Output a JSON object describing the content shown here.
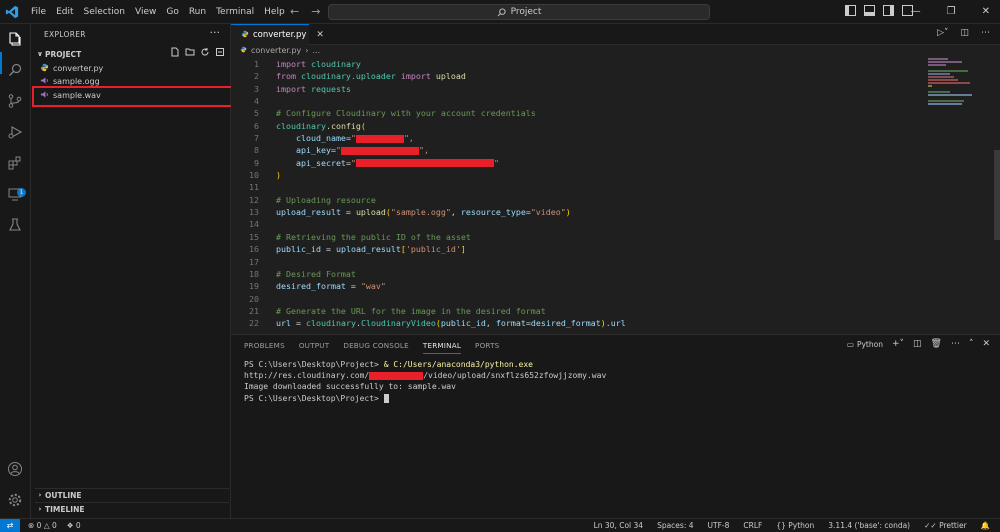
{
  "menu": [
    "File",
    "Edit",
    "Selection",
    "View",
    "Go",
    "Run",
    "Terminal",
    "Help"
  ],
  "command_center": {
    "label": "Project"
  },
  "sidebar": {
    "title": "EXPLORER",
    "more": "···",
    "project": "PROJECT",
    "files": [
      {
        "name": "converter.py",
        "icon": "python-file-icon"
      },
      {
        "name": "sample.ogg",
        "icon": "audio-file-icon"
      },
      {
        "name": "sample.wav",
        "icon": "audio-file-icon"
      }
    ],
    "outline": "OUTLINE",
    "timeline": "TIMELINE"
  },
  "editor": {
    "tab_label": "converter.py",
    "breadcrumb": [
      "converter.py",
      "..."
    ],
    "line_numbers": [
      "1",
      "2",
      "3",
      "4",
      "5",
      "6",
      "7",
      "8",
      "9",
      "10",
      "11",
      "12",
      "13",
      "14",
      "15",
      "16",
      "17",
      "18",
      "19",
      "20",
      "21",
      "22"
    ]
  },
  "code": {
    "l1_kw": "import",
    "l1_mod": " cloudinary",
    "l2_kw": "from",
    "l2_mod": " cloudinary.uploader ",
    "l2_kw2": "import",
    "l2_fn": " upload",
    "l3_kw": "import",
    "l3_mod": " requests",
    "l5": "# Configure Cloudinary with your account credentials",
    "l6_mod": "cloudinary",
    "l6_fn": ".config",
    "l6_br": "(",
    "l7_var": "    cloud_name",
    "l7_eq": "=",
    "l7_q": "\"",
    "l7_end": "\",",
    "l8_var": "    api_key",
    "l8_eq": "=",
    "l8_q": "\"",
    "l8_end": "\",",
    "l9_var": "    api_secret",
    "l9_eq": "=",
    "l9_q": "\"",
    "l9_end": "\"",
    "l10": ")",
    "l12": "# Uploading resource",
    "l13_var": "upload_result",
    "l13_eq": " = ",
    "l13_fn": "upload",
    "l13_p1": "(",
    "l13_s1": "\"sample.ogg\"",
    "l13_c": ", ",
    "l13_var2": "resource_type",
    "l13_eq2": "=",
    "l13_s2": "\"video\"",
    "l13_p2": ")",
    "l15": "# Retrieving the public ID of the asset",
    "l16_var": "public_id",
    "l16_eq": " = ",
    "l16_var2": "upload_result",
    "l16_b1": "[",
    "l16_s": "'public_id'",
    "l16_b2": "]",
    "l18": "# Desired Format",
    "l19_var": "desired_format",
    "l19_eq": " = ",
    "l19_s": "\"wav\"",
    "l21": "# Generate the URL for the image in the desired format",
    "l22_var": "url",
    "l22_eq": " = ",
    "l22_mod": "cloudinary",
    "l22_dot": ".",
    "l22_fn": "CloudinaryVideo",
    "l22_p1": "(",
    "l22_var2": "public_id",
    "l22_c": ", ",
    "l22_var3": "format",
    "l22_eq2": "=",
    "l22_var4": "desired_format",
    "l22_p2": ")",
    "l22_tail": ".url"
  },
  "panel": {
    "tabs": [
      "PROBLEMS",
      "OUTPUT",
      "DEBUG CONSOLE",
      "TERMINAL",
      "PORTS"
    ],
    "active_tab": "TERMINAL",
    "terminal_name": "Python",
    "term_l1_prompt": "PS C:\\Users\\Desktop\\Project> ",
    "term_l1_cmd": "& C:/Users/anaconda3/python.exe",
    "term_l2_a": "http://res.cloudinary.com/",
    "term_l2_b": "/video/upload/snxflzs652zfowjjzomy.wav",
    "term_l3": "Image downloaded successfully to: sample.wav",
    "term_l4": "PS C:\\Users\\Desktop\\Project> "
  },
  "statusbar": {
    "errors": "0",
    "warnings": "0",
    "ports": "0",
    "position": "Ln 30, Col 34",
    "spaces": "Spaces: 4",
    "encoding": "UTF-8",
    "eol": "CRLF",
    "language": "Python",
    "interpreter": "3.11.4 ('base': conda)",
    "formatter": "Prettier"
  },
  "colors": {
    "accent": "#0078d4",
    "highlight": "#e8202a",
    "background": "#1f1f1f"
  }
}
